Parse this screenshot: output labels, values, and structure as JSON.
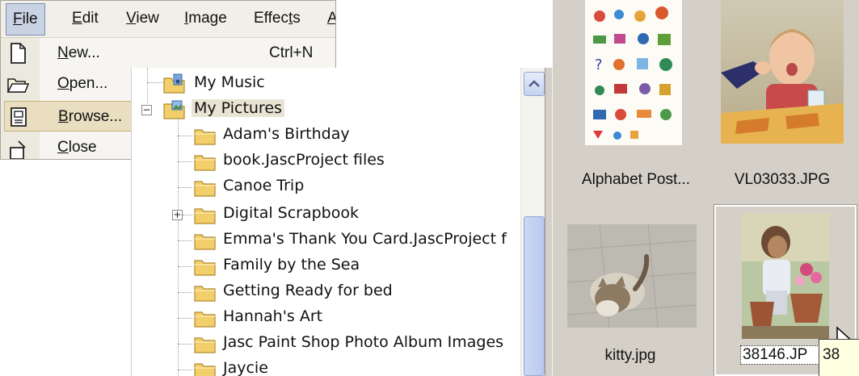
{
  "menubar": {
    "items": [
      {
        "label": "File",
        "accel": "F",
        "rest": "ile"
      },
      {
        "label": "Edit",
        "accel": "E",
        "rest": "dit"
      },
      {
        "label": "View",
        "accel": "V",
        "rest": "iew"
      },
      {
        "label": "Image",
        "accel": "I",
        "rest": "mage"
      },
      {
        "label": "Effects",
        "pre": "Effec",
        "accel": "t",
        "rest": "s"
      },
      {
        "label": "A",
        "accel": "A",
        "rest": ""
      }
    ]
  },
  "file_menu": {
    "items": [
      {
        "label_accel": "N",
        "label_rest": "ew...",
        "shortcut": "Ctrl+N",
        "icon": "new-document-icon"
      },
      {
        "label_accel": "O",
        "label_rest": "pen...",
        "shortcut": "",
        "icon": "open-folder-icon"
      },
      {
        "label_accel": "B",
        "label_rest": "rowse...",
        "shortcut": "",
        "icon": "browse-icon",
        "highlighted": true
      },
      {
        "label_accel": "C",
        "label_rest": "lose",
        "shortcut": "",
        "icon": "close-icon"
      }
    ]
  },
  "tree": {
    "items": [
      {
        "label": "My Music",
        "level": 0
      },
      {
        "label": "My Pictures",
        "level": 0,
        "expander": "−",
        "selected": true
      },
      {
        "label": "Adam's Birthday",
        "level": 1
      },
      {
        "label": "book.JascProject files",
        "level": 1
      },
      {
        "label": "Canoe Trip",
        "level": 1
      },
      {
        "label": "Digital Scrapbook",
        "level": 1,
        "expander": "+"
      },
      {
        "label": "Emma's Thank You Card.JascProject f",
        "level": 1
      },
      {
        "label": "Family by the Sea",
        "level": 1
      },
      {
        "label": "Getting Ready for bed",
        "level": 1
      },
      {
        "label": "Hannah's Art",
        "level": 1
      },
      {
        "label": "Jasc Paint Shop Photo Album Images",
        "level": 1
      },
      {
        "label": "Jaycie",
        "level": 1
      }
    ]
  },
  "thumbnails": {
    "items": [
      {
        "caption": "Alphabet Post...",
        "image": "alphabet-poster-thumbnail"
      },
      {
        "caption": "VL03033.JPG",
        "image": "child-at-table-thumbnail"
      },
      {
        "caption": "kitty.jpg",
        "image": "kitten-thumbnail"
      },
      {
        "caption": "38146.JP",
        "image": "girl-with-flowers-thumbnail",
        "selected": true
      }
    ],
    "tooltip": "38"
  },
  "colors": {
    "menu_bg": "#f6f5f1",
    "highlight": "#e9dec0",
    "thumb_panel_bg": "#d4d0c8",
    "folder_yellow": "#f2cf6b",
    "scrollbar_blue": "#b9c8ee"
  }
}
